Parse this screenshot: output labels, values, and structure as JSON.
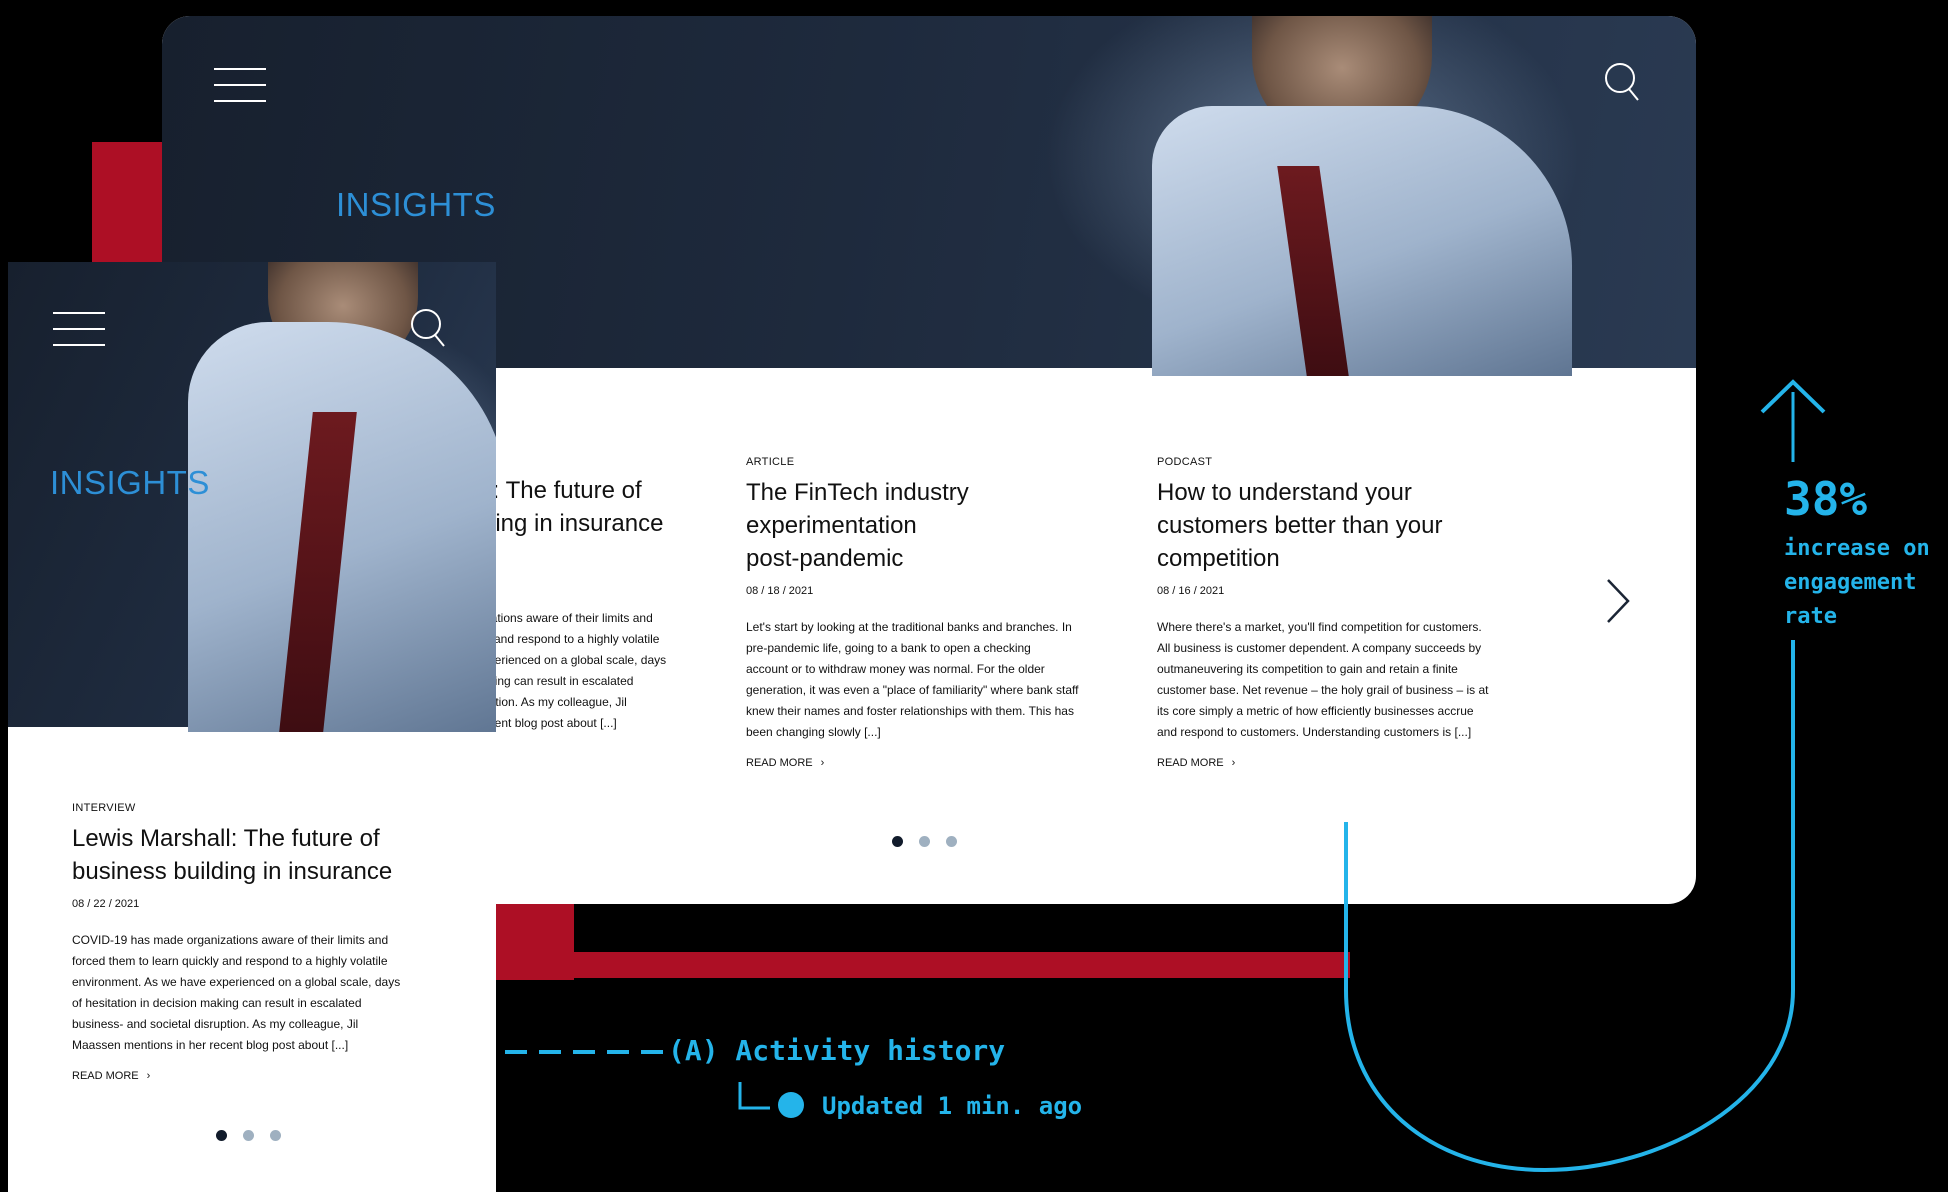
{
  "colors": {
    "accent_blue": "#2d8fd6",
    "annotation_blue": "#24b4ea",
    "brand_red": "#ad0f25",
    "hero_dark": "#1b2535"
  },
  "desktop": {
    "hero_title": "INSIGHTS",
    "menu_icon": "hamburger-icon",
    "search_icon": "search-icon",
    "partial_article": {
      "headline_lines": [
        "ll: The future of",
        "ding in insurance"
      ],
      "excerpt_lines": [
        "izations aware of their limits and",
        "ly and respond to a highly volatile",
        "xperienced on a global scale, days",
        "aking can result in escalated",
        "uption.  As my colleague, Jil",
        "ecent blog post about [...]"
      ]
    },
    "articles": [
      {
        "tag": "ARTICLE",
        "headline_lines": [
          "The FinTech industry",
          "experimentation",
          "post-pandemic"
        ],
        "date": "08 / 18 / 2021",
        "excerpt_lines": [
          "Let's start by looking at the traditional banks and branches. In",
          "pre-pandemic life, going to a bank to open a checking",
          "account or to withdraw money was normal. For the older",
          "generation, it was even a \"place of familiarity\" where bank staff",
          "knew their names and foster relationships with them. This has",
          "been changing slowly [...]"
        ],
        "read_more": "READ MORE"
      },
      {
        "tag": "PODCAST",
        "headline_lines": [
          "How to understand your",
          "customers better than your",
          "competition"
        ],
        "date": "08 / 16 / 2021",
        "excerpt_lines": [
          "Where there's a market, you'll find competition for customers.",
          "All business is customer dependent. A company succeeds by",
          "outmaneuvering its competition to gain and retain a finite",
          "customer base. Net revenue – the holy grail of business – is at",
          "its core simply a metric of how efficiently businesses accrue",
          "and respond to customers. Understanding customers is [...]"
        ],
        "read_more": "READ MORE"
      }
    ],
    "next_icon": "chevron-right-icon",
    "pagination": {
      "pages": 3,
      "active": 1
    }
  },
  "mobile": {
    "hero_title": "INSIGHTS",
    "article": {
      "tag": "INTERVIEW",
      "headline_lines": [
        "Lewis Marshall: The future of",
        "business building in insurance"
      ],
      "date": "08 / 22 / 2021",
      "excerpt_lines": [
        "COVID-19 has made organizations aware of their limits and",
        "forced them to learn quickly and respond to a highly volatile",
        "environment. As we have experienced on a global scale, days",
        "of hesitation in decision making can result in escalated",
        "business- and societal disruption.  As my colleague, Jil",
        "Maassen mentions in her recent blog post about [...]"
      ],
      "read_more": "READ MORE"
    },
    "pagination": {
      "pages": 3,
      "active": 1
    }
  },
  "annotations": {
    "stat_value": "38%",
    "stat_caption_lines": [
      "increase on",
      "engagement",
      "rate"
    ],
    "activity_label": "(A) Activity history",
    "updated_label": "Updated 1 min. ago"
  }
}
